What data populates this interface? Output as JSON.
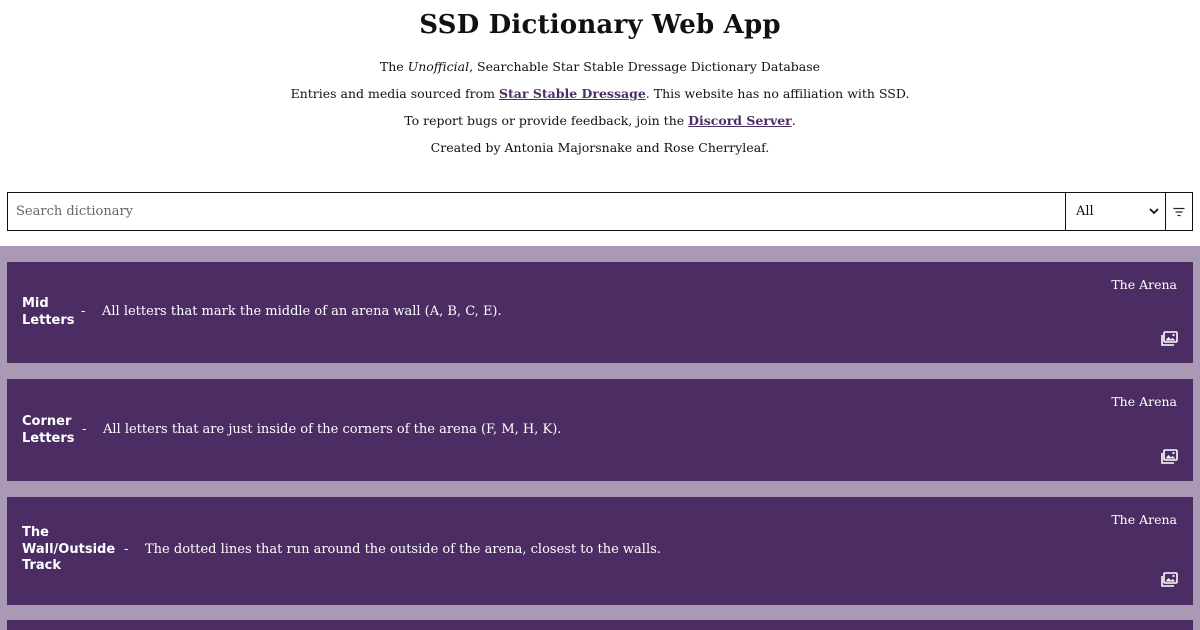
{
  "header": {
    "title": "SSD Dictionary Web App",
    "line1_pre": "The ",
    "line1_em": "Unofficial",
    "line1_post": ", Searchable Star Stable Dressage Dictionary Database",
    "line2_pre": "Entries and media sourced from ",
    "line2_link": "Star Stable Dressage",
    "line2_post": ". This website has no affiliation with SSD.",
    "line3_pre": "To report bugs or provide feedback, join the ",
    "line3_link": "Discord Server",
    "line3_post": ".",
    "line4": "Created by Antonia Majorsnake and Rose Cherryleaf."
  },
  "search": {
    "placeholder": "Search dictionary",
    "value": "",
    "category_selected": "All",
    "filter_icon": "filter-icon"
  },
  "entries": [
    {
      "term_lines": [
        "Mid",
        "Letters"
      ],
      "separator": "-",
      "definition": "All letters that mark the middle of an arena wall (A, B, C, E).",
      "category": "The Arena",
      "media_icon": "image-gallery-icon"
    },
    {
      "term_lines": [
        "Corner",
        "Letters"
      ],
      "separator": "-",
      "definition": "All letters that are just inside of the corners of the arena (F, M, H, K).",
      "category": "The Arena",
      "media_icon": "image-gallery-icon"
    },
    {
      "term_lines": [
        "The",
        "Wall/Outside",
        "Track"
      ],
      "separator": "-",
      "definition": "The dotted lines that run around the outside of the arena, closest to the walls.",
      "category": "The Arena",
      "media_icon": "image-gallery-icon"
    }
  ],
  "colors": {
    "entry_bg": "#4b2d63",
    "results_bg": "#a999b4",
    "link": "#4b2e63"
  }
}
